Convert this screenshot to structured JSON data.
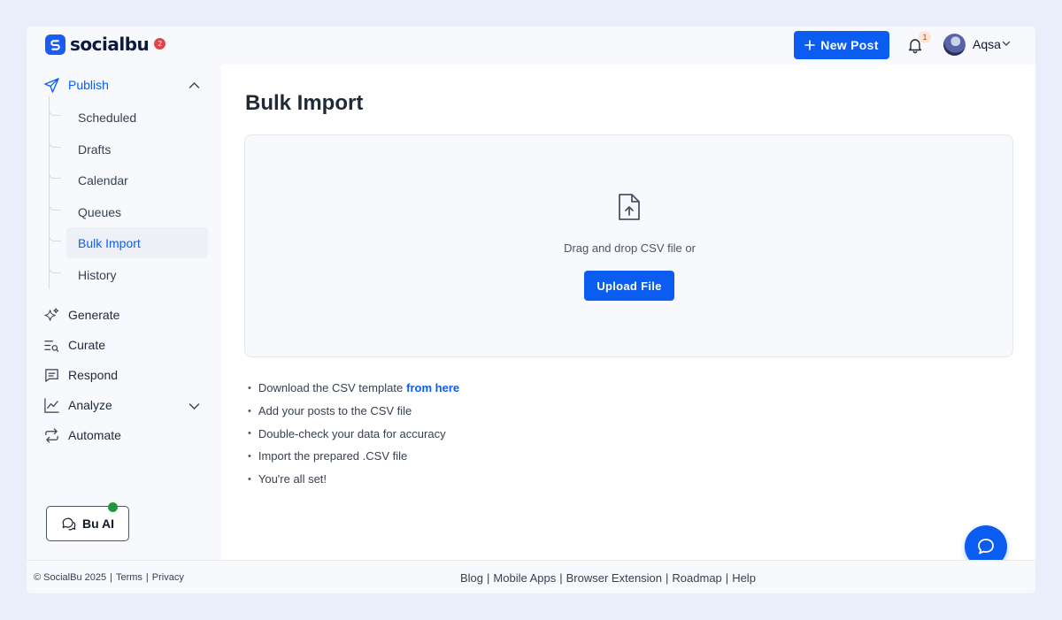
{
  "brand": {
    "name": "socialbu",
    "badge": "2",
    "color": "#1b5cf3"
  },
  "header": {
    "new_post_label": "New Post",
    "notification_count": "1",
    "user_name": "Aqsa"
  },
  "sidebar": {
    "publish": {
      "label": "Publish",
      "items": [
        "Scheduled",
        "Drafts",
        "Calendar",
        "Queues",
        "Bulk Import",
        "History"
      ],
      "active_item": "Bulk Import"
    },
    "items": [
      {
        "label": "Generate",
        "icon": "sparkle-icon"
      },
      {
        "label": "Curate",
        "icon": "search-list-icon"
      },
      {
        "label": "Respond",
        "icon": "message-icon"
      },
      {
        "label": "Analyze",
        "icon": "chart-line-icon"
      },
      {
        "label": "Automate",
        "icon": "repeat-icon"
      }
    ],
    "bu_ai_label": "Bu AI"
  },
  "main": {
    "title": "Bulk Import",
    "dropzone_text": "Drag and drop CSV file or",
    "upload_label": "Upload File",
    "steps": [
      {
        "text": "Download the CSV template",
        "link": "from here"
      },
      {
        "text": "Add your posts to the CSV file"
      },
      {
        "text": "Double-check your data for accuracy"
      },
      {
        "text": "Import the prepared .CSV file"
      },
      {
        "text": "You're all set!"
      }
    ]
  },
  "footer": {
    "copyright": "© SocialBu 2025",
    "terms": "Terms",
    "privacy": "Privacy",
    "links": [
      "Blog",
      "Mobile Apps",
      "Browser Extension",
      "Roadmap",
      "Help"
    ]
  },
  "colors": {
    "accent": "#0b5cf0",
    "background": "#e8effb"
  }
}
